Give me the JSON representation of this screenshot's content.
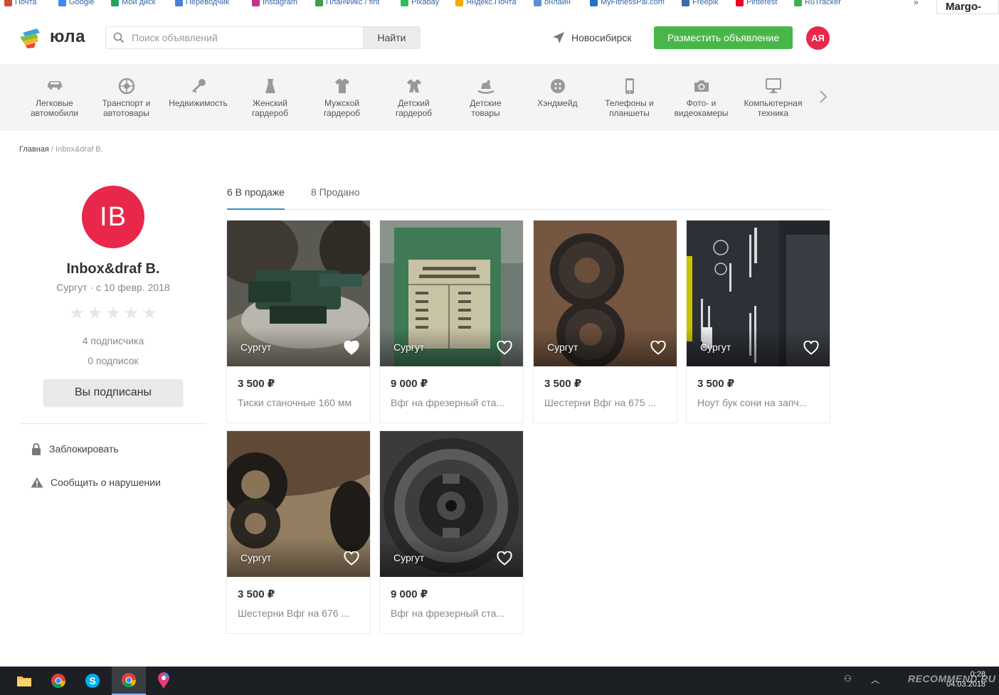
{
  "browser": {
    "bookmarks": [
      {
        "label": "Почта",
        "color": "#d04a3a"
      },
      {
        "label": "Google",
        "color": "#4285f4"
      },
      {
        "label": "Мой диск",
        "color": "#1fa463"
      },
      {
        "label": "Переводчик",
        "color": "#4a7fd8"
      },
      {
        "label": "Instagram",
        "color": "#c13584"
      },
      {
        "label": "ПланФикс / fint",
        "color": "#3aa04a"
      },
      {
        "label": "Pixabay",
        "color": "#2ebd59"
      },
      {
        "label": "Яндекс.Почта",
        "color": "#f2a900"
      },
      {
        "label": "онлайн",
        "color": "#5b8fd6"
      },
      {
        "label": "MyFitnessPal.com",
        "color": "#1b74c9"
      },
      {
        "label": "Freepik",
        "color": "#3a6ea5"
      },
      {
        "label": "Pinterest",
        "color": "#e60023"
      },
      {
        "label": "RuTracker",
        "color": "#3cae5a"
      }
    ],
    "more": "»",
    "user": "Margo-sib"
  },
  "header": {
    "logo_text": "юла",
    "search_placeholder": "Поиск объявлений",
    "search_button": "Найти",
    "city": "Новосибирск",
    "post_button": "Разместить объявление",
    "avatar_initials": "АЯ",
    "accent_green": "#49b748",
    "avatar_color": "#e8274b"
  },
  "categories": [
    {
      "label": "Легковые\nавтомобили",
      "icon": "car-icon"
    },
    {
      "label": "Транспорт и\nавтотовары",
      "icon": "wheel-icon"
    },
    {
      "label": "Недвижимость",
      "icon": "key-icon"
    },
    {
      "label": "Женский\nгардероб",
      "icon": "dress-icon"
    },
    {
      "label": "Мужской\nгардероб",
      "icon": "shirt-icon"
    },
    {
      "label": "Детский\nгардероб",
      "icon": "baby-clothes-icon"
    },
    {
      "label": "Детские\nтовары",
      "icon": "rocking-horse-icon"
    },
    {
      "label": "Хэндмейд",
      "icon": "button-icon"
    },
    {
      "label": "Телефоны и\nпланшеты",
      "icon": "phone-icon"
    },
    {
      "label": "Фото- и\nвидеокамеры",
      "icon": "camera-icon"
    },
    {
      "label": "Компьютерная\nтехника",
      "icon": "monitor-icon"
    }
  ],
  "breadcrumb": {
    "home": "Главная",
    "separator": " / ",
    "current": "Inbox&draf B."
  },
  "profile": {
    "initials": "IB",
    "name": "Inbox&draf B.",
    "meta": "Сургут · с 10 февр. 2018",
    "rating": 0,
    "followers": "4 подписчика",
    "following": "0 подписок",
    "subscribe_button": "Вы подписаны",
    "block_label": "Заблокировать",
    "report_label": "Сообщить о нарушении"
  },
  "tabs": [
    {
      "label": "6 В продаже",
      "active": true
    },
    {
      "label": "8 Продано",
      "active": false
    }
  ],
  "listings": [
    {
      "location": "Сургут",
      "price": "3 500 ₽",
      "title": "Тиски станочные 160 мм",
      "favorited": true,
      "photo": "vise"
    },
    {
      "location": "Сургут",
      "price": "9 000 ₽",
      "title": "Вфг на фрезерный ста...",
      "favorited": false,
      "photo": "plate"
    },
    {
      "location": "Сургут",
      "price": "3 500 ₽",
      "title": "Шестерни Вфг на 675 ...",
      "favorited": false,
      "photo": "gears"
    },
    {
      "location": "Сургут",
      "price": "3 500 ₽",
      "title": "Ноут бук сони на запч...",
      "favorited": false,
      "photo": "laptop"
    },
    {
      "location": "Сургут",
      "price": "3 500 ₽",
      "title": "Шестерни Вфг на 676 ...",
      "favorited": false,
      "photo": "gears2"
    },
    {
      "location": "Сургут",
      "price": "9 000 ₽",
      "title": "Вфг на фрезерный ста...",
      "favorited": false,
      "photo": "spindle"
    }
  ],
  "taskbar": {
    "clock_time": "0:28",
    "clock_date": "04.03.2018",
    "watermark": "RECOMMEND.RU"
  }
}
